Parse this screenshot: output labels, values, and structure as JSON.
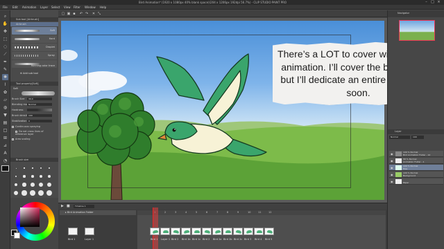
{
  "window": {
    "title": "Bird Animation* (1920 x 1080px 40% blank space)(204 x 1206px 192dpi 56.7%) - CLIP STUDIO PAINT PRO"
  },
  "menu": [
    "File",
    "Edit",
    "Animation",
    "Layer",
    "Select",
    "View",
    "Filter",
    "Window",
    "Help"
  ],
  "brush_panel": {
    "header": "Sub tool [Airbrush]",
    "group": "Airbrush",
    "brushes": [
      {
        "name": "Soft",
        "selected": true
      },
      {
        "name": "Hard",
        "selected": false
      },
      {
        "name": "Droplet",
        "selected": false
      },
      {
        "name": "Spray",
        "selected": false
      },
      {
        "name": "Running color trace",
        "selected": false
      }
    ],
    "add_label": "Add sub tool"
  },
  "tool_property": {
    "header": "Tool property[Soft]",
    "name": "Soft",
    "rows": [
      {
        "label": "Brush Size",
        "value": "30.0"
      },
      {
        "label": "Blending mode",
        "value": "Normal"
      },
      {
        "label": "Hardness",
        "value": ""
      },
      {
        "label": "Brush density",
        "value": "100"
      },
      {
        "label": "Stabilization",
        "value": "0"
      }
    ],
    "checks": [
      "Continuous spraying",
      "Do not cross lines of reference layer",
      "Area scaling"
    ]
  },
  "brush_size_panel": {
    "header": "Brush size"
  },
  "note": {
    "text": "There’s a LOT to cover with keyframe animation. I’ll cover the basics here, but I’ll dedicate an entire tutorial to it soon."
  },
  "navigator": {
    "header": "Navigator"
  },
  "layers": {
    "header": "Layer",
    "blend": "Normal",
    "opacity": "100",
    "items": [
      {
        "name": "100 % Normal",
        "sub": "Bird Animation Folder - 12",
        "selected": false
      },
      {
        "name": "58 % Normal",
        "sub": "Animation Folder - 1",
        "selected": false
      },
      {
        "name": "100 % Normal",
        "sub": "Tree",
        "selected": true
      },
      {
        "name": "100 % Normal",
        "sub": "Background",
        "selected": false
      },
      {
        "name": "",
        "sub": "Paper",
        "selected": false
      }
    ]
  },
  "timeline": {
    "name": "Timeline 1",
    "track_name": "Bird Animation Folder",
    "ruler": [
      "1",
      "2",
      "3",
      "4",
      "5",
      "6",
      "7",
      "8",
      "9",
      "10",
      "11",
      "12"
    ],
    "left_cels": [
      {
        "label": "Bird 1"
      },
      {
        "label": "Layer 1"
      }
    ],
    "cels": [
      {
        "label": "Bird 1"
      },
      {
        "label": "Layer 1"
      },
      {
        "label": "Bird 2"
      },
      {
        "label": "Bird 1b"
      },
      {
        "label": "Bird 1c"
      },
      {
        "label": "Bird 2"
      },
      {
        "label": "Bird 2a"
      },
      {
        "label": "Bird 2b"
      },
      {
        "label": "Bird 2c"
      },
      {
        "label": "Bird 3"
      },
      {
        "label": "Bird 4"
      },
      {
        "label": "Bird 5"
      }
    ]
  },
  "colors": {
    "bird_green": "#3aa56c",
    "bird_cream": "#f7f2d6",
    "beak": "#e0883a",
    "tree_green": "#2f7d2c",
    "trunk": "#6b4a3a",
    "sky_top": "#4a8fd8",
    "grass": "#6aaf3a",
    "panel_bg": "#474747",
    "accent": "#6f7f99"
  }
}
